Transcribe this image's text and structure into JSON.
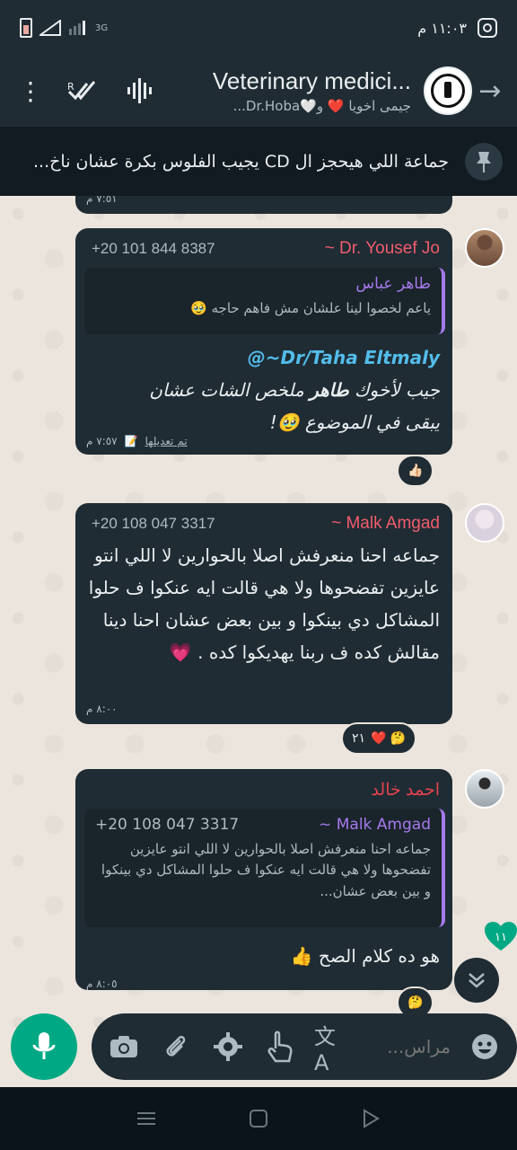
{
  "status_bar": {
    "time": "١١:٠٣ م",
    "network": "3G"
  },
  "header": {
    "title": "Veterinary medici...",
    "subtitle": "جيمى اخويا ❤️ و🤍Dr.Hoba..."
  },
  "pinned": {
    "text": "جماعة اللي هيحجز ال CD يجيب الفلوس بكرة عشان ناخ..."
  },
  "messages": {
    "prev_time": "٧:٥١ م",
    "m1": {
      "sender_name": "~ Dr. Yousef Jo",
      "sender_phone": "+20 101 844 8387",
      "quote_name": "طاهر عباس",
      "quote_text": "ياعم لخصوا لينا علشان مش فاهم حاجه 🥹",
      "mention": "@~Dr/Taha Eltmaly",
      "line1_a": "جيب لأخوك ",
      "line1_b": "طاهر",
      "line1_c": " ملخص الشات عشان",
      "line2": "يبقى في الموضوع 🥹!",
      "edited": "تم تعديلها",
      "time": "٧:٥٧ م",
      "reaction": "👍🏻"
    },
    "m2": {
      "sender_name": "~ Malk Amgad",
      "sender_phone": "+20 108 047 3317",
      "text": "جماعه احنا منعرفش اصلا بالحوارين لا اللي انتو عايزين تفضحوها ولا هي قالت ايه عنكوا ف حلوا المشاكل دي بينكوا و بين بعض عشان احنا دينا مقالش كده ف ربنا يهديكوا كده . 💗",
      "time": "٨:٠٠ م",
      "reactions": "❤️ 🤔",
      "reaction_count": "٢١"
    },
    "m3": {
      "sender_name": "احمد خالد",
      "quote_name": "~ Malk Amgad",
      "quote_phone": "+20 108 047 3317",
      "quote_text": "جماعه احنا منعرفش اصلا بالحوارين لا اللي انتو عايزين تفضحوها ولا هي قالت ايه عنكوا ف حلوا المشاكل دي بينكوا و بين بعض عشان...",
      "text": "هو ده كلام الصح 👍",
      "time": "٨:٠٥ م",
      "reaction": "🤔"
    },
    "unread_count": "١١"
  },
  "input": {
    "placeholder": "مراس..."
  },
  "colors": {
    "accent": "#00a884",
    "bubble": "#1f2c34",
    "mention": "#53bdeb",
    "sender_pink": "#f15c6d",
    "sender_red": "#e6424f",
    "quote_purple": "#a57aeb"
  }
}
